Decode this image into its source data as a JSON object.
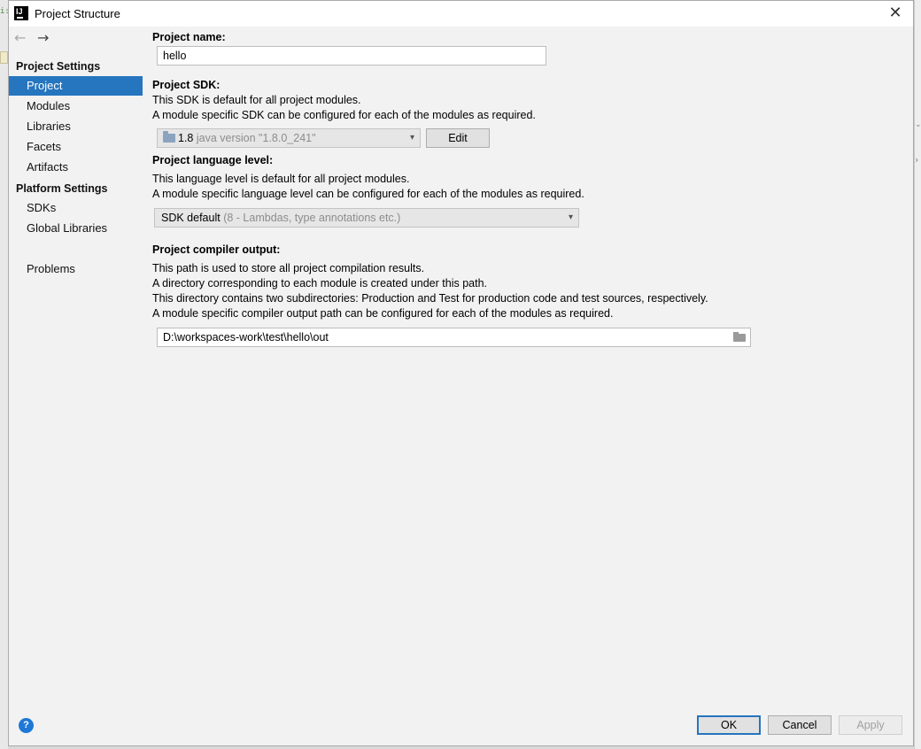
{
  "window": {
    "title": "Project Structure"
  },
  "sidebar": {
    "groups": [
      {
        "title": "Project Settings",
        "items": [
          "Project",
          "Modules",
          "Libraries",
          "Facets",
          "Artifacts"
        ]
      },
      {
        "title": "Platform Settings",
        "items": [
          "SDKs",
          "Global Libraries"
        ]
      }
    ],
    "extra_items": [
      "Problems"
    ],
    "selected": "Project"
  },
  "project_name": {
    "label": "Project name:",
    "value": "hello"
  },
  "project_sdk": {
    "label": "Project SDK:",
    "desc": [
      "This SDK is default for all project modules.",
      "A module specific SDK can be configured for each of the modules as required."
    ],
    "selected_version": "1.8",
    "selected_detail": "java version \"1.8.0_241\"",
    "edit_label": "Edit"
  },
  "language_level": {
    "label": "Project language level:",
    "desc": [
      "This language level is default for all project modules.",
      "A module specific language level can be configured for each of the modules as required."
    ],
    "selected": "SDK default",
    "selected_detail": "(8 - Lambdas, type annotations etc.)"
  },
  "compiler_output": {
    "label": "Project compiler output:",
    "desc": [
      "This path is used to store all project compilation results.",
      "A directory corresponding to each module is created under this path.",
      "This directory contains two subdirectories: Production and Test for production code and test sources, respectively.",
      "A module specific compiler output path can be configured for each of the modules as required."
    ],
    "path": "D:\\workspaces-work\\test\\hello\\out"
  },
  "footer": {
    "help": "?",
    "ok_label": "OK",
    "cancel_label": "Cancel",
    "apply_label": "Apply"
  }
}
